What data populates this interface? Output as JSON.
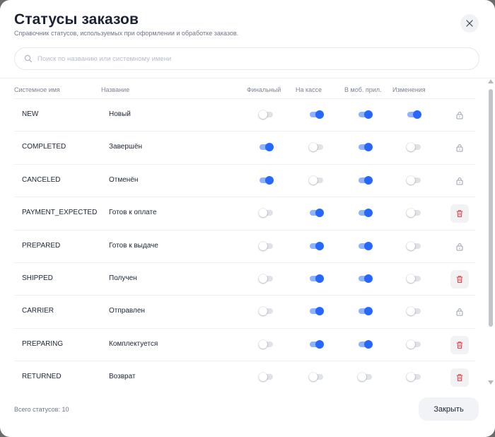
{
  "title": "Статусы заказов",
  "subtitle": "Справочник статусов, используемых при оформлении и обработке заказов.",
  "search": {
    "placeholder": "Поиск по названию или системному имени",
    "value": ""
  },
  "columns": {
    "system_name": "Системное имя",
    "name": "Название",
    "final": "Финальный",
    "pos": "На кассе",
    "mobile": "В моб. прил.",
    "editable": "Изменения"
  },
  "rows": [
    {
      "system_name": "NEW",
      "name": "Новый",
      "final": false,
      "pos": true,
      "mobile": true,
      "editable": true,
      "action": "lock-icon"
    },
    {
      "system_name": "COMPLETED",
      "name": "Завершён",
      "final": true,
      "pos": false,
      "mobile": true,
      "editable": false,
      "action": "lock-icon"
    },
    {
      "system_name": "CANCELED",
      "name": "Отменён",
      "final": true,
      "pos": false,
      "mobile": true,
      "editable": false,
      "action": "lock-icon"
    },
    {
      "system_name": "PAYMENT_EXPECTED",
      "name": "Готов к оплате",
      "final": false,
      "pos": true,
      "mobile": true,
      "editable": false,
      "action": "trash-icon"
    },
    {
      "system_name": "PREPARED",
      "name": "Готов к выдаче",
      "final": false,
      "pos": true,
      "mobile": true,
      "editable": false,
      "action": "lock-icon"
    },
    {
      "system_name": "SHIPPED",
      "name": "Получен",
      "final": false,
      "pos": true,
      "mobile": true,
      "editable": false,
      "action": "trash-icon"
    },
    {
      "system_name": "CARRIER",
      "name": "Отправлен",
      "final": false,
      "pos": true,
      "mobile": true,
      "editable": false,
      "action": "lock-icon"
    },
    {
      "system_name": "PREPARING",
      "name": "Комплектуется",
      "final": false,
      "pos": true,
      "mobile": true,
      "editable": false,
      "action": "trash-icon"
    },
    {
      "system_name": "RETURNED",
      "name": "Возврат",
      "final": false,
      "pos": false,
      "mobile": false,
      "editable": false,
      "action": "trash-icon"
    }
  ],
  "footer": {
    "total_label": "Всего статусов: 10",
    "close_label": "Закрыть"
  },
  "colors": {
    "accent": "#2667ff",
    "toggle_on_track": "#8fb2ff",
    "toggle_off_track": "#dfe3e8",
    "delete": "#e0404a",
    "lock": "#9aa1ac"
  }
}
